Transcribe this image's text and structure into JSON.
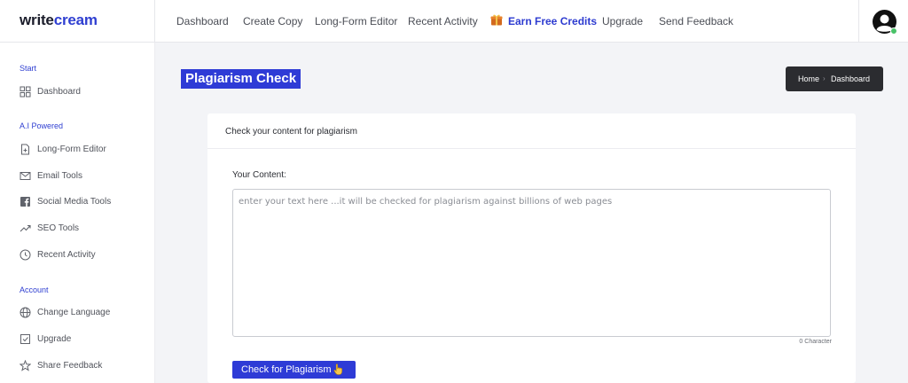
{
  "logo": {
    "part1": "write",
    "part2": "cream"
  },
  "nav": {
    "dashboard": "Dashboard",
    "create_copy": "Create Copy",
    "long_form_editor": "Long-Form Editor",
    "recent_activity": "Recent Activity",
    "earn_free_credits": "Earn Free Credits",
    "upgrade": "Upgrade",
    "send_feedback": "Send Feedback"
  },
  "sidebar": {
    "sections": [
      {
        "title": "Start",
        "items": [
          {
            "label": "Dashboard",
            "icon": "grid-icon"
          }
        ]
      },
      {
        "title": "A.I Powered",
        "items": [
          {
            "label": "Long-Form Editor",
            "icon": "document-plus-icon"
          },
          {
            "label": "Email Tools",
            "icon": "mail-icon"
          },
          {
            "label": "Social Media Tools",
            "icon": "facebook-icon"
          },
          {
            "label": "SEO Tools",
            "icon": "trending-up-icon"
          },
          {
            "label": "Recent Activity",
            "icon": "clock-icon"
          }
        ]
      },
      {
        "title": "Account",
        "items": [
          {
            "label": "Change Language",
            "icon": "globe-icon"
          },
          {
            "label": "Upgrade",
            "icon": "checkbox-icon"
          },
          {
            "label": "Share Feedback",
            "icon": "star-icon"
          }
        ]
      }
    ]
  },
  "page": {
    "title": "Plagiarism Check",
    "breadcrumb": {
      "home": "Home",
      "current": "Dashboard"
    }
  },
  "card": {
    "title": "Check your content for plagiarism",
    "content_label": "Your Content:",
    "textarea_placeholder": "enter your text here ...it will be checked for plagiarism against billions of web pages",
    "textarea_value": "",
    "char_count": "0 Character",
    "check_button": "Check for Plagiarism"
  },
  "colors": {
    "accent": "#2e3bd6",
    "breadcrumb_bg": "#2b2c30",
    "online": "#49c268"
  }
}
